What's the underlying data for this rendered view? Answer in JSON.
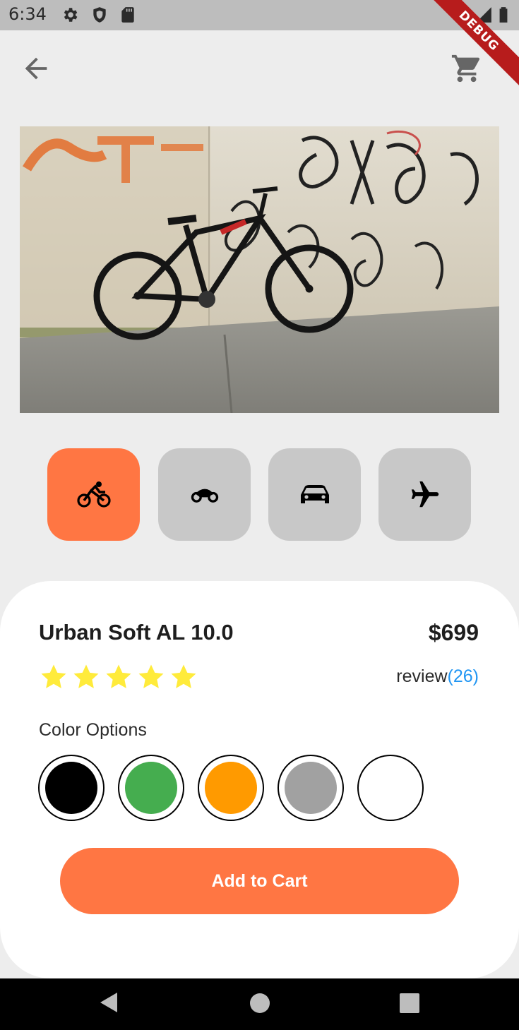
{
  "status_bar": {
    "time": "6:34"
  },
  "debug_banner": "DEBUG",
  "product": {
    "name": "Urban Soft AL 10.0",
    "price": "$699",
    "rating": 5,
    "review_label": "review",
    "review_count": "(26)"
  },
  "categories": [
    {
      "icon": "bicycle-icon",
      "selected": true
    },
    {
      "icon": "motorcycle-icon",
      "selected": false
    },
    {
      "icon": "car-icon",
      "selected": false
    },
    {
      "icon": "airplane-icon",
      "selected": false
    }
  ],
  "color_options": {
    "label": "Color Options",
    "colors": [
      "#000000",
      "#45ad4f",
      "#ff9a00",
      "#a1a1a1",
      "#ffffff"
    ]
  },
  "add_to_cart_label": "Add to Cart",
  "accent_color": "#ff7643",
  "link_color": "#2196f3"
}
